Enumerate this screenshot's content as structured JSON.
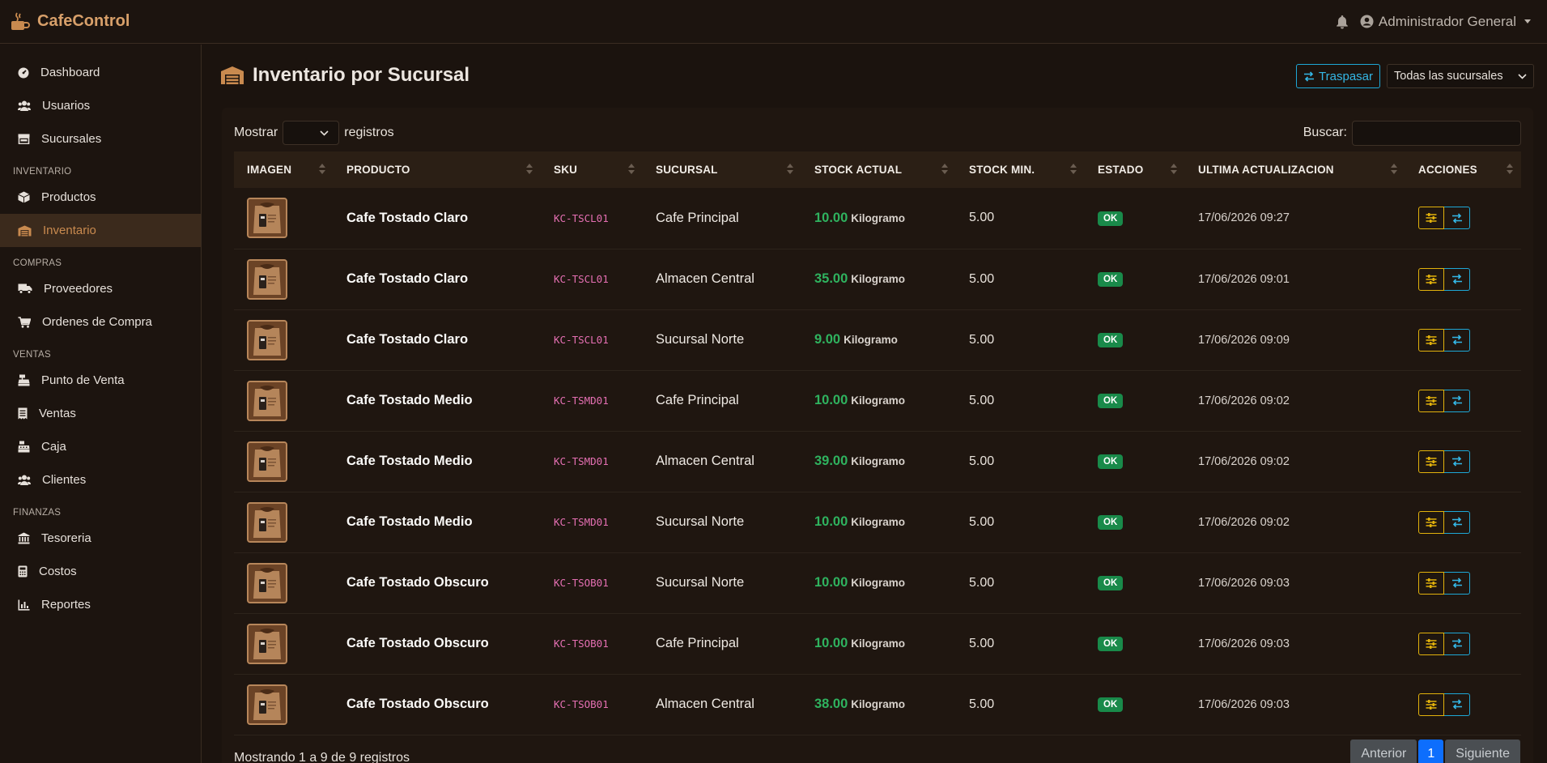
{
  "app": {
    "title": "CafeControl"
  },
  "header": {
    "user_name": "Administrador General"
  },
  "sidebar": {
    "items": [
      {
        "label": "Dashboard",
        "icon": "dashboard-icon"
      },
      {
        "label": "Usuarios",
        "icon": "users-icon"
      },
      {
        "label": "Sucursales",
        "icon": "store-icon"
      }
    ],
    "sections": [
      {
        "title": "INVENTARIO",
        "items": [
          {
            "label": "Productos",
            "icon": "box-icon"
          },
          {
            "label": "Inventario",
            "icon": "warehouse-icon",
            "active": true
          }
        ]
      },
      {
        "title": "COMPRAS",
        "items": [
          {
            "label": "Proveedores",
            "icon": "truck-icon"
          },
          {
            "label": "Ordenes de Compra",
            "icon": "cart-icon"
          }
        ]
      },
      {
        "title": "VENTAS",
        "items": [
          {
            "label": "Punto de Venta",
            "icon": "cash-register-icon"
          },
          {
            "label": "Ventas",
            "icon": "receipt-icon"
          },
          {
            "label": "Caja",
            "icon": "cashbox-icon"
          },
          {
            "label": "Clientes",
            "icon": "clients-icon"
          }
        ]
      },
      {
        "title": "FINANZAS",
        "items": [
          {
            "label": "Tesoreria",
            "icon": "bank-icon"
          },
          {
            "label": "Costos",
            "icon": "calculator-icon"
          },
          {
            "label": "Reportes",
            "icon": "chart-icon"
          }
        ]
      }
    ]
  },
  "page": {
    "title": "Inventario por Sucursal",
    "transfer_button": "Traspasar",
    "branch_select": "Todas las sucursales"
  },
  "table_controls": {
    "show_label": "Mostrar",
    "records_label": "registros",
    "search_label": "Buscar:",
    "search_value": ""
  },
  "table": {
    "columns": [
      "IMAGEN",
      "PRODUCTO",
      "SKU",
      "SUCURSAL",
      "STOCK ACTUAL",
      "STOCK MIN.",
      "ESTADO",
      "ULTIMA ACTUALIZACION",
      "ACCIONES"
    ],
    "rows": [
      {
        "product": "Cafe Tostado Claro",
        "sku": "KC-TSCL01",
        "branch": "Cafe Principal",
        "stock": "10.00",
        "unit": "Kilogramo",
        "min": "5.00",
        "status": "OK",
        "updated": "17/06/2026 09:27"
      },
      {
        "product": "Cafe Tostado Claro",
        "sku": "KC-TSCL01",
        "branch": "Almacen Central",
        "stock": "35.00",
        "unit": "Kilogramo",
        "min": "5.00",
        "status": "OK",
        "updated": "17/06/2026 09:01"
      },
      {
        "product": "Cafe Tostado Claro",
        "sku": "KC-TSCL01",
        "branch": "Sucursal Norte",
        "stock": "9.00",
        "unit": "Kilogramo",
        "min": "5.00",
        "status": "OK",
        "updated": "17/06/2026 09:09"
      },
      {
        "product": "Cafe Tostado Medio",
        "sku": "KC-TSMD01",
        "branch": "Cafe Principal",
        "stock": "10.00",
        "unit": "Kilogramo",
        "min": "5.00",
        "status": "OK",
        "updated": "17/06/2026 09:02"
      },
      {
        "product": "Cafe Tostado Medio",
        "sku": "KC-TSMD01",
        "branch": "Almacen Central",
        "stock": "39.00",
        "unit": "Kilogramo",
        "min": "5.00",
        "status": "OK",
        "updated": "17/06/2026 09:02"
      },
      {
        "product": "Cafe Tostado Medio",
        "sku": "KC-TSMD01",
        "branch": "Sucursal Norte",
        "stock": "10.00",
        "unit": "Kilogramo",
        "min": "5.00",
        "status": "OK",
        "updated": "17/06/2026 09:02"
      },
      {
        "product": "Cafe Tostado Obscuro",
        "sku": "KC-TSOB01",
        "branch": "Sucursal Norte",
        "stock": "10.00",
        "unit": "Kilogramo",
        "min": "5.00",
        "status": "OK",
        "updated": "17/06/2026 09:03"
      },
      {
        "product": "Cafe Tostado Obscuro",
        "sku": "KC-TSOB01",
        "branch": "Cafe Principal",
        "stock": "10.00",
        "unit": "Kilogramo",
        "min": "5.00",
        "status": "OK",
        "updated": "17/06/2026 09:03"
      },
      {
        "product": "Cafe Tostado Obscuro",
        "sku": "KC-TSOB01",
        "branch": "Almacen Central",
        "stock": "38.00",
        "unit": "Kilogramo",
        "min": "5.00",
        "status": "OK",
        "updated": "17/06/2026 09:03"
      }
    ]
  },
  "footer": {
    "info": "Mostrando 1 a 9 de 9 registros",
    "prev": "Anterior",
    "current_page": "1",
    "next": "Siguiente"
  },
  "colors": {
    "brand": "#d8a06a",
    "stock_ok": "#2fb35f",
    "badge_ok": "#198a4a",
    "adjust_button": "#e2b20c",
    "transfer_button": "#1ea7d6"
  }
}
